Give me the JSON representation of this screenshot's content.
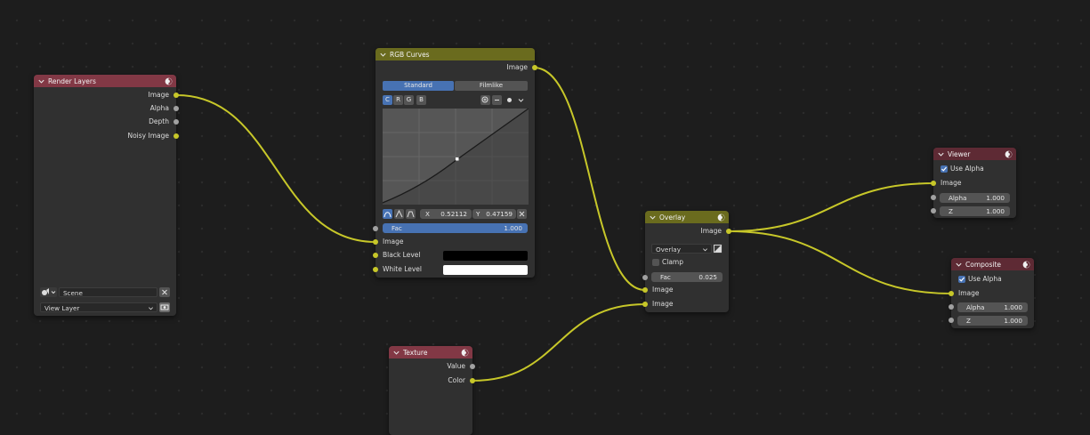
{
  "colors": {
    "background": "#1d1d1d",
    "node_body": "#303030",
    "header_input": "#823845",
    "header_color": "#6a6b1e",
    "header_output": "#5e2a34",
    "socket_color": "#c7c729",
    "socket_value": "#a1a1a1",
    "accent_blue": "#4772b3",
    "link_color": "#c7c729"
  },
  "render_layers": {
    "title": "Render Layers",
    "outputs": [
      "Image",
      "Alpha",
      "Depth",
      "Noisy Image"
    ],
    "scene": "Scene",
    "view_layer": "View Layer",
    "icons": [
      "collapse-chevron-icon",
      "scene-icon",
      "clear-x-icon",
      "render-layer-icon"
    ]
  },
  "rgb_curves": {
    "title": "RGB Curves",
    "output": "Image",
    "modes": [
      "Standard",
      "Filmlike"
    ],
    "channels": [
      "C",
      "R",
      "G",
      "B"
    ],
    "x_label": "X",
    "x_value": "0.52112",
    "y_label": "Y",
    "y_value": "0.47159",
    "fac_label": "Fac",
    "fac_value": "1.000",
    "inputs": [
      "Image",
      "Black Level",
      "White Level"
    ],
    "black_level_color": "#000000",
    "white_level_color": "#ffffff"
  },
  "overlay": {
    "title": "Overlay",
    "output": "Image",
    "blend_mode": "Overlay",
    "clamp_label": "Clamp",
    "fac_label": "Fac",
    "fac_value": "0.025",
    "inputs": [
      "Image",
      "Image"
    ]
  },
  "viewer": {
    "title": "Viewer",
    "use_alpha_label": "Use Alpha",
    "input": "Image",
    "alpha_label": "Alpha",
    "alpha_value": "1.000",
    "z_label": "Z",
    "z_value": "1.000"
  },
  "composite": {
    "title": "Composite",
    "use_alpha_label": "Use Alpha",
    "input": "Image",
    "alpha_label": "Alpha",
    "alpha_value": "1.000",
    "z_label": "Z",
    "z_value": "1.000"
  },
  "texture": {
    "title": "Texture",
    "outputs": [
      "Value",
      "Color"
    ]
  }
}
